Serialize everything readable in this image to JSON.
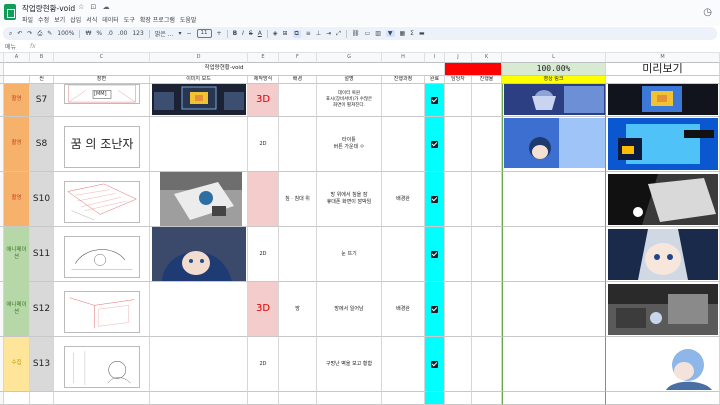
{
  "app": {
    "doc_title": "작업량현황-void",
    "menu": [
      "파일",
      "수정",
      "보기",
      "삽입",
      "서식",
      "데이터",
      "도구",
      "확장 프로그램",
      "도움말"
    ]
  },
  "toolbar": {
    "zoom": "100%",
    "currency": "₩",
    "percent": "%",
    "dec_less": ".0",
    "dec_more": ".00",
    "number_format": "123",
    "font": "맑은 ...",
    "font_size": "11",
    "bold": "B",
    "italic": "I",
    "strike": "S",
    "text_color": "A"
  },
  "formula_bar": {
    "name_box": "메뉴",
    "fx": "fx",
    "value": ""
  },
  "columns": [
    "A",
    "B",
    "C",
    "D",
    "E",
    "F",
    "G",
    "H",
    "I",
    "J",
    "K",
    "L",
    "M"
  ],
  "sheet": {
    "merged_title": "작업량현황-void",
    "percent": "100.00%",
    "preview_title": "미리보기",
    "headers": {
      "scene": "씬",
      "storyboard": "장면",
      "image_board": "이미지 보드",
      "production": "제작방식",
      "background": "배경",
      "description": "설명",
      "progress": "진행과정",
      "done": "완료",
      "assignee": "담당자",
      "rate": "진행율",
      "video_link": "영상 링크"
    },
    "rows": [
      {
        "num": "3",
        "category": "촬영",
        "scene": "S7",
        "production": "3D",
        "background": "",
        "description": "데이터 복원\n표시(장비서버)가 수많은\n화면이 펼쳐진다.",
        "progress": "",
        "done": true
      },
      {
        "num": "4",
        "category": "촬영",
        "scene": "S8",
        "production": "2D",
        "background": "",
        "description": "타이틀\n버튼 가운데 ㅇ",
        "progress": "",
        "done": true
      },
      {
        "num": "5",
        "category": "촬영",
        "scene": "S10",
        "production": "",
        "background": "침 · 침대 위",
        "description": "방 위에서 침을 잠\n휴대폰 화면이 깜박임",
        "progress": "배경완",
        "done": true
      },
      {
        "num": "6",
        "category": "애니메이션",
        "scene": "S11",
        "production": "2D",
        "background": "",
        "description": "눈 뜨기",
        "progress": "",
        "done": true
      },
      {
        "num": "7",
        "category": "애니메이션",
        "scene": "S12",
        "production": "3D",
        "background": "방",
        "description": "방에서 일어남",
        "progress": "배경완",
        "done": true
      },
      {
        "num": "8",
        "category": "수집",
        "scene": "S13",
        "production": "2D",
        "background": "",
        "description": "구멍난 벽을 보고 황함",
        "progress": "",
        "done": true
      }
    ],
    "sketch_texts": {
      "s7_caption": "[MM]",
      "s8_title": "꿈 의 조난자"
    }
  },
  "colors": {
    "category_shoot": "#f6b26b",
    "category_anim": "#b6d7a8",
    "category_collect": "#ffe599",
    "three_d": "#e00000",
    "done": "#00ffff",
    "rate_header": "#ff0000",
    "link_header": "#ffff00",
    "preview_header": "#d9ead3"
  }
}
